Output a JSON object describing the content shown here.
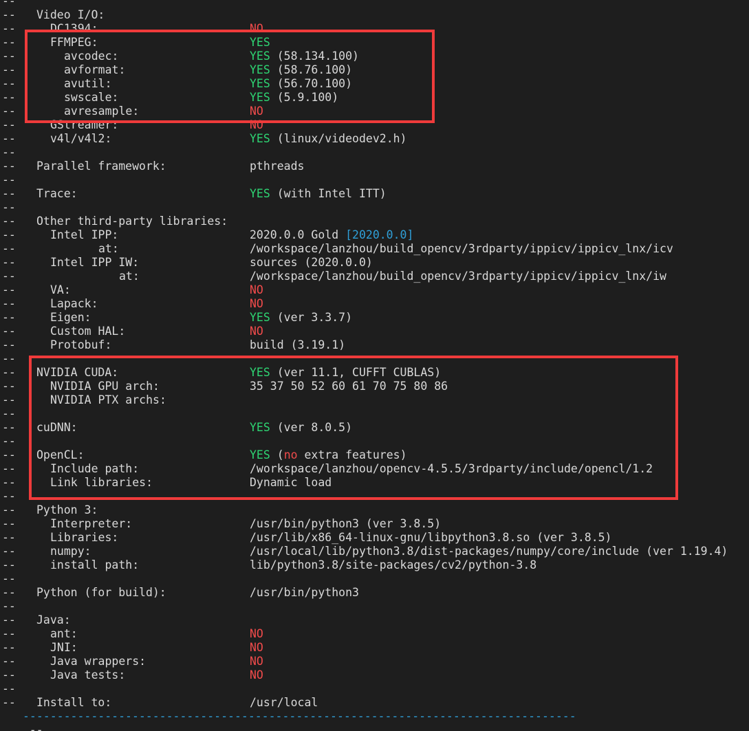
{
  "terminal": {
    "prefix": "--",
    "lines": [
      {
        "label": "",
        "indent": 0,
        "value": []
      },
      {
        "label": "Video I/O:",
        "indent": 1,
        "value": []
      },
      {
        "label": "DC1394:",
        "indent": 2,
        "value": [
          {
            "t": "NO",
            "c": "red"
          }
        ]
      },
      {
        "label": "FFMPEG:",
        "indent": 2,
        "value": [
          {
            "t": "YES",
            "c": "green"
          }
        ]
      },
      {
        "label": "avcodec:",
        "indent": 3,
        "value": [
          {
            "t": "YES",
            "c": "green"
          },
          {
            "t": " (58.134.100)",
            "c": ""
          }
        ]
      },
      {
        "label": "avformat:",
        "indent": 3,
        "value": [
          {
            "t": "YES",
            "c": "green"
          },
          {
            "t": " (58.76.100)",
            "c": ""
          }
        ]
      },
      {
        "label": "avutil:",
        "indent": 3,
        "value": [
          {
            "t": "YES",
            "c": "green"
          },
          {
            "t": " (56.70.100)",
            "c": ""
          }
        ]
      },
      {
        "label": "swscale:",
        "indent": 3,
        "value": [
          {
            "t": "YES",
            "c": "green"
          },
          {
            "t": " (5.9.100)",
            "c": ""
          }
        ]
      },
      {
        "label": "avresample:",
        "indent": 3,
        "value": [
          {
            "t": "NO",
            "c": "red"
          }
        ]
      },
      {
        "label": "GStreamer:",
        "indent": 2,
        "value": [
          {
            "t": "NO",
            "c": "red"
          }
        ]
      },
      {
        "label": "v4l/v4l2:",
        "indent": 2,
        "value": [
          {
            "t": "YES",
            "c": "green"
          },
          {
            "t": " (linux/videodev2.h)",
            "c": ""
          }
        ]
      },
      {
        "label": "",
        "indent": 0,
        "value": []
      },
      {
        "label": "Parallel framework:",
        "indent": 1,
        "value": [
          {
            "t": "pthreads",
            "c": ""
          }
        ]
      },
      {
        "label": "",
        "indent": 0,
        "value": []
      },
      {
        "label": "Trace:",
        "indent": 1,
        "value": [
          {
            "t": "YES",
            "c": "green"
          },
          {
            "t": " (with Intel ITT)",
            "c": ""
          }
        ]
      },
      {
        "label": "",
        "indent": 0,
        "value": []
      },
      {
        "label": "Other third-party libraries:",
        "indent": 1,
        "value": []
      },
      {
        "label": "Intel IPP:",
        "indent": 2,
        "value": [
          {
            "t": "2020.0.0 Gold ",
            "c": ""
          },
          {
            "t": "[2020.0.0]",
            "c": "blue"
          }
        ]
      },
      {
        "label": "at:",
        "indent": 5,
        "value": [
          {
            "t": "/workspace/lanzhou/build_opencv/3rdparty/ippicv/ippicv_lnx/icv",
            "c": ""
          }
        ]
      },
      {
        "label": "Intel IPP IW:",
        "indent": 2,
        "value": [
          {
            "t": "sources (2020.0.0)",
            "c": ""
          }
        ]
      },
      {
        "label": "at:",
        "indent": 6,
        "value": [
          {
            "t": "/workspace/lanzhou/build_opencv/3rdparty/ippicv/ippicv_lnx/iw",
            "c": ""
          }
        ]
      },
      {
        "label": "VA:",
        "indent": 2,
        "value": [
          {
            "t": "NO",
            "c": "red"
          }
        ]
      },
      {
        "label": "Lapack:",
        "indent": 2,
        "value": [
          {
            "t": "NO",
            "c": "red"
          }
        ]
      },
      {
        "label": "Eigen:",
        "indent": 2,
        "value": [
          {
            "t": "YES",
            "c": "green"
          },
          {
            "t": " (ver 3.3.7)",
            "c": ""
          }
        ]
      },
      {
        "label": "Custom HAL:",
        "indent": 2,
        "value": [
          {
            "t": "NO",
            "c": "red"
          }
        ]
      },
      {
        "label": "Protobuf:",
        "indent": 2,
        "value": [
          {
            "t": "build (3.19.1)",
            "c": ""
          }
        ]
      },
      {
        "label": "",
        "indent": 0,
        "value": []
      },
      {
        "label": "NVIDIA CUDA:",
        "indent": 1,
        "value": [
          {
            "t": "YES",
            "c": "green"
          },
          {
            "t": " (ver 11.1, CUFFT CUBLAS)",
            "c": ""
          }
        ]
      },
      {
        "label": "NVIDIA GPU arch:",
        "indent": 2,
        "value": [
          {
            "t": "35 37 50 52 60 61 70 75 80 86",
            "c": ""
          }
        ]
      },
      {
        "label": "NVIDIA PTX archs:",
        "indent": 2,
        "value": []
      },
      {
        "label": "",
        "indent": 0,
        "value": []
      },
      {
        "label": "cuDNN:",
        "indent": 1,
        "value": [
          {
            "t": "YES",
            "c": "green"
          },
          {
            "t": " (ver 8.0.5)",
            "c": ""
          }
        ]
      },
      {
        "label": "",
        "indent": 0,
        "value": []
      },
      {
        "label": "OpenCL:",
        "indent": 1,
        "value": [
          {
            "t": "YES",
            "c": "green"
          },
          {
            "t": " (",
            "c": ""
          },
          {
            "t": "no",
            "c": "red"
          },
          {
            "t": " extra features)",
            "c": ""
          }
        ]
      },
      {
        "label": "Include path:",
        "indent": 2,
        "value": [
          {
            "t": "/workspace/lanzhou/opencv-4.5.5/3rdparty/include/opencl/1.2",
            "c": ""
          }
        ]
      },
      {
        "label": "Link libraries:",
        "indent": 2,
        "value": [
          {
            "t": "Dynamic load",
            "c": ""
          }
        ]
      },
      {
        "label": "",
        "indent": 0,
        "value": []
      },
      {
        "label": "Python 3:",
        "indent": 1,
        "value": []
      },
      {
        "label": "Interpreter:",
        "indent": 2,
        "value": [
          {
            "t": "/usr/bin/python3 (ver 3.8.5)",
            "c": ""
          }
        ]
      },
      {
        "label": "Libraries:",
        "indent": 2,
        "value": [
          {
            "t": "/usr/lib/x86_64-linux-gnu/libpython3.8.so (ver 3.8.5)",
            "c": ""
          }
        ]
      },
      {
        "label": "numpy:",
        "indent": 2,
        "value": [
          {
            "t": "/usr/local/lib/python3.8/dist-packages/numpy/core/include (ver 1.19.4)",
            "c": ""
          }
        ]
      },
      {
        "label": "install path:",
        "indent": 2,
        "value": [
          {
            "t": "lib/python3.8/site-packages/cv2/python-3.8",
            "c": ""
          }
        ]
      },
      {
        "label": "",
        "indent": 0,
        "value": []
      },
      {
        "label": "Python (for build):",
        "indent": 1,
        "value": [
          {
            "t": "/usr/bin/python3",
            "c": ""
          }
        ]
      },
      {
        "label": "",
        "indent": 0,
        "value": []
      },
      {
        "label": "Java:",
        "indent": 1,
        "value": []
      },
      {
        "label": "ant:",
        "indent": 2,
        "value": [
          {
            "t": "NO",
            "c": "red"
          }
        ]
      },
      {
        "label": "JNI:",
        "indent": 2,
        "value": [
          {
            "t": "NO",
            "c": "red"
          }
        ]
      },
      {
        "label": "Java wrappers:",
        "indent": 2,
        "value": [
          {
            "t": "NO",
            "c": "red"
          }
        ]
      },
      {
        "label": "Java tests:",
        "indent": 2,
        "value": [
          {
            "t": "NO",
            "c": "red"
          }
        ]
      },
      {
        "label": "",
        "indent": 0,
        "value": []
      },
      {
        "label": "Install to:",
        "indent": 1,
        "value": [
          {
            "t": "/usr/local",
            "c": ""
          }
        ]
      }
    ],
    "rule": "---------------------------------------------------------------------------------"
  },
  "colors": {
    "background": "#1e1e1e",
    "text": "#d9d9d9",
    "yes": "#2ed573",
    "no": "#f04b4b",
    "link": "#2f9fd8",
    "annotation": "#ef3b3b"
  }
}
